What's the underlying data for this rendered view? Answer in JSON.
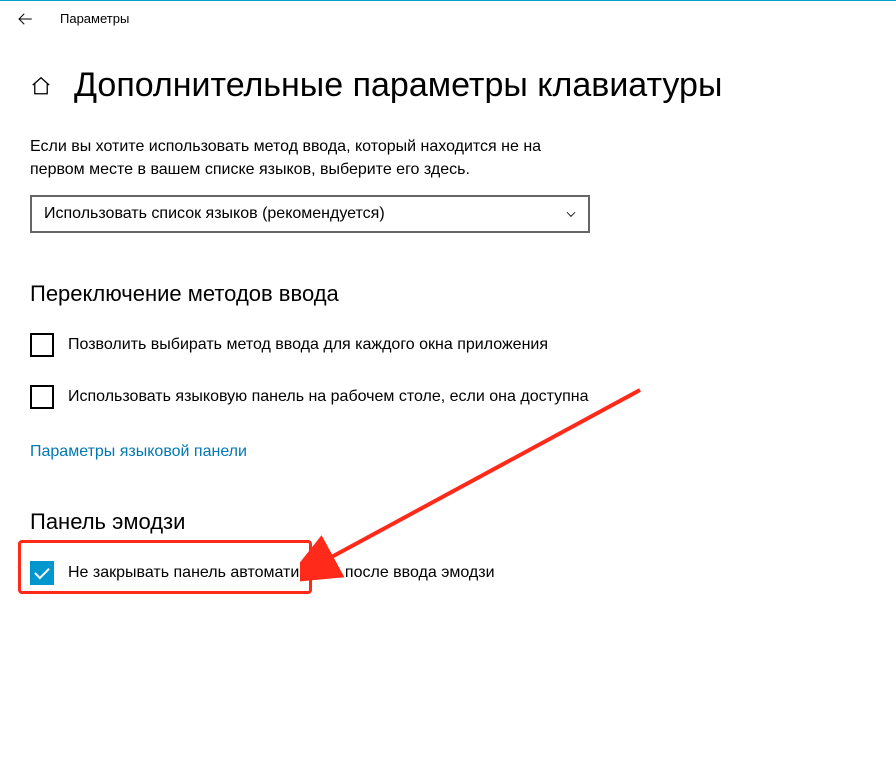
{
  "titlebar": {
    "app_name": "Параметры"
  },
  "page": {
    "title": "Дополнительные параметры клавиатуры",
    "description": "Если вы хотите использовать метод ввода, который находится не на первом месте в вашем списке языков, выберите его здесь.",
    "dropdown_value": "Использовать список языков (рекомендуется)"
  },
  "section_switch": {
    "heading": "Переключение методов ввода",
    "chk_per_window": "Позволить выбирать метод ввода для каждого окна приложения",
    "chk_lang_bar": "Использовать языковую панель на рабочем столе, если она доступна",
    "link_langbar_options": "Параметры языковой панели"
  },
  "section_emoji": {
    "heading": "Панель эмодзи",
    "chk_no_close": "Не закрывать панель автоматически после ввода эмодзи"
  }
}
